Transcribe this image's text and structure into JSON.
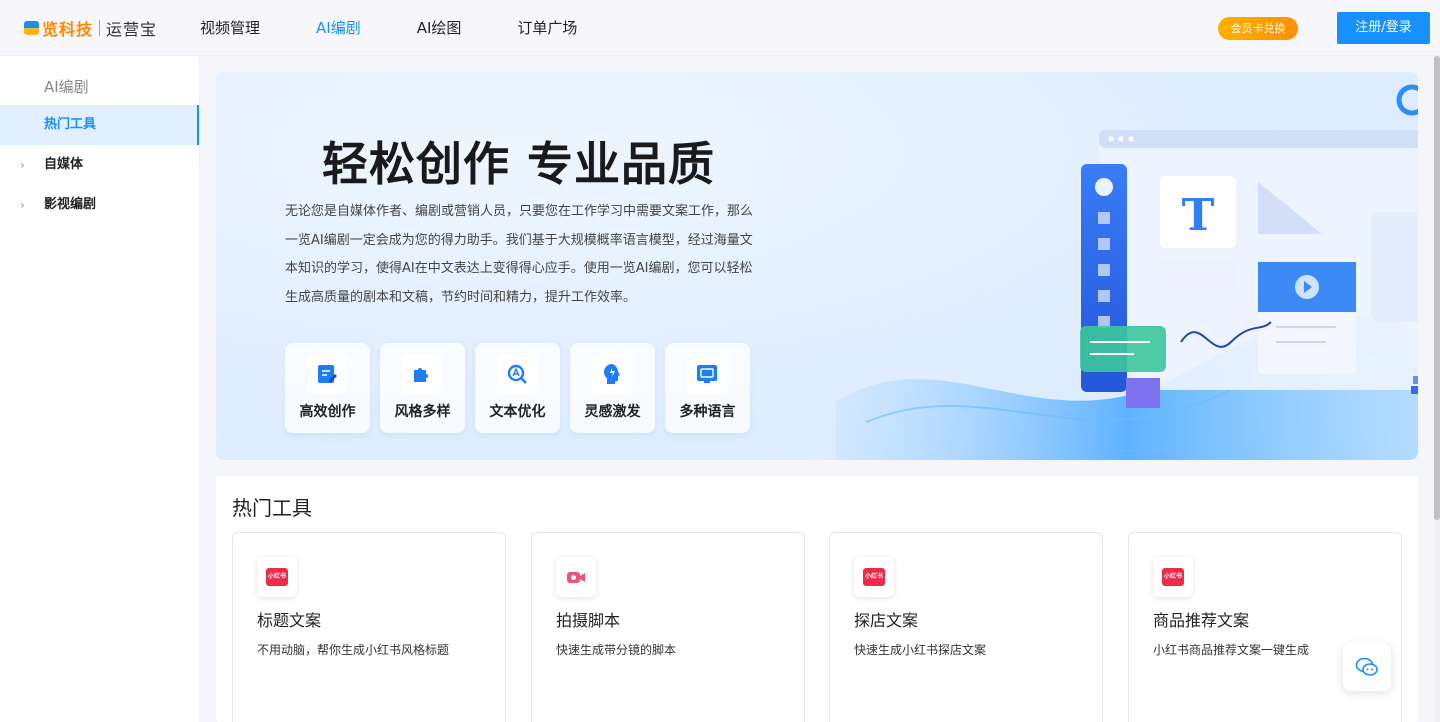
{
  "header": {
    "logo_brand": "览科技",
    "logo_sub": "运营宝",
    "nav": [
      {
        "label": "视频管理",
        "active": false
      },
      {
        "label": "AI编剧",
        "active": true
      },
      {
        "label": "AI绘图",
        "active": false
      },
      {
        "label": "订单广场",
        "active": false
      }
    ],
    "vip_label": "会员卡兑换",
    "login_label": "注册/登录"
  },
  "sidebar": {
    "title": "AI编剧",
    "items": [
      {
        "label": "热门工具",
        "active": true,
        "expandable": false
      },
      {
        "label": "自媒体",
        "active": false,
        "expandable": true
      },
      {
        "label": "影视编剧",
        "active": false,
        "expandable": true
      }
    ]
  },
  "banner": {
    "headline": "轻松创作 专业品质",
    "description": "无论您是自媒体作者、编剧或营销人员，只要您在工作学习中需要文案工作，那么一览AI编剧一定会成为您的得力助手。我们基于大规模概率语言模型，经过海量文本知识的学习，使得AI在中文表达上变得得心应手。使用一览AI编剧，您可以轻松生成高质量的剧本和文稿，节约时间和精力，提升工作效率。",
    "features": [
      {
        "label": "高效创作",
        "icon": "edit-doc-icon"
      },
      {
        "label": "风格多样",
        "icon": "puzzle-icon"
      },
      {
        "label": "文本优化",
        "icon": "text-search-icon"
      },
      {
        "label": "灵感激发",
        "icon": "idea-head-icon"
      },
      {
        "label": "多种语言",
        "icon": "language-screen-icon"
      }
    ]
  },
  "hot_tools": {
    "title": "热门工具",
    "cards": [
      {
        "title": "标题文案",
        "desc": "不用动脑，帮你生成小红书风格标题",
        "icon": "xiaohongshu-icon",
        "icon_text": "小红书"
      },
      {
        "title": "拍摄脚本",
        "desc": "快速生成带分镜的脚本",
        "icon": "video-camera-icon",
        "icon_text": ""
      },
      {
        "title": "探店文案",
        "desc": "快速生成小红书探店文案",
        "icon": "xiaohongshu-icon",
        "icon_text": "小红书"
      },
      {
        "title": "商品推荐文案",
        "desc": "小红书商品推荐文案一键生成",
        "icon": "xiaohongshu-icon",
        "icon_text": "小红书"
      }
    ]
  },
  "colors": {
    "accent": "#1890ff",
    "vip": "#ff9800",
    "xiaohongshu": "#ee2a49"
  }
}
